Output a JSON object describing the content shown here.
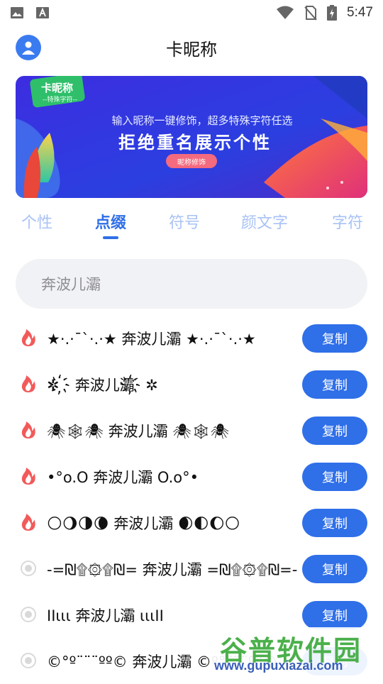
{
  "status_bar": {
    "time": "5:47",
    "icons": [
      "image-icon",
      "text-a-icon",
      "wifi-icon",
      "no-sim-icon",
      "battery-charging-icon"
    ]
  },
  "header": {
    "title": "卡昵称",
    "avatar_icon": "user-icon"
  },
  "banner": {
    "badge_title": "卡昵称",
    "badge_sub": "--特殊字符--",
    "subtitle": "输入昵称一键修饰，超多特殊字符任选",
    "headline": "拒绝重名展示个性",
    "pill": "昵称修饰"
  },
  "tabs": [
    {
      "label": "个性"
    },
    {
      "label": "点缀"
    },
    {
      "label": "符号"
    },
    {
      "label": "颜文字"
    },
    {
      "label": "字符"
    }
  ],
  "active_tab": "点缀",
  "search": {
    "placeholder": "奔波儿灞"
  },
  "list": [
    {
      "text": "★·.·¯`·.·★ 奔波儿灞 ★·.·¯`·.·★",
      "icon": "fire-icon",
      "copy": "复制"
    },
    {
      "text": "✲ ҉ 奔波儿灞҉ ✲",
      "icon": "fire-icon",
      "copy": "复制"
    },
    {
      "text": "🕷🕸🕷 奔波儿灞 🕷🕸🕷",
      "icon": "fire-icon",
      "copy": "复制"
    },
    {
      "text": "•°o.O 奔波儿灞 O.o°•",
      "icon": "fire-icon",
      "copy": "复制"
    },
    {
      "text": "🌕🌖🌗🌘 奔波儿灞 🌒🌓🌔🌕",
      "icon": "fire-icon",
      "copy": "复制"
    },
    {
      "text": "-=₪۩۞۩₪= 奔波儿灞 =₪۩۞۩₪=-",
      "icon": "radio-dot-icon",
      "copy": "复制"
    },
    {
      "text": "ΙΙιιι 奔波儿灞 ιιιΙΙ",
      "icon": "radio-dot-icon",
      "copy": "复制"
    },
    {
      "text": "©°º¨¨¨ºº© 奔波儿灞 ©º°¨¨¨º°©",
      "icon": "radio-dot-icon",
      "copy": "复制"
    }
  ],
  "watermark": {
    "cn": "谷普软件园",
    "url": "www.gupuxiazai.com"
  },
  "colors": {
    "accent": "#2f6fe8",
    "fire": "#f25a5a",
    "inactive_tab": "#a9c2f5",
    "search_bg": "#f1f2f5"
  }
}
